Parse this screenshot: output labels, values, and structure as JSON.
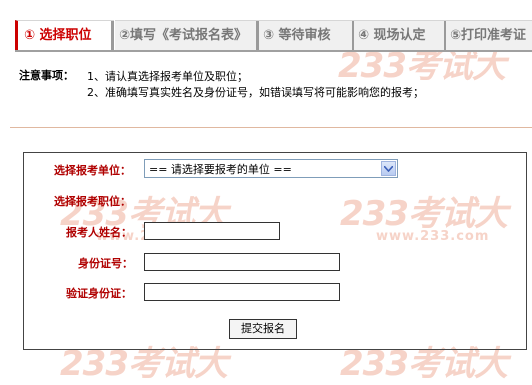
{
  "steps": [
    {
      "label": "① 选择职位"
    },
    {
      "label": "②填写《考试报名表》"
    },
    {
      "label": "③ 等待审核"
    },
    {
      "label": "④ 现场认定"
    },
    {
      "label": "⑤打印准考证"
    }
  ],
  "notes": {
    "title": "注意事项：",
    "lines": [
      "1、请认真选择报考单位及职位；",
      "2、准确填写真实姓名及身份证号，如错误填写将可能影响您的报考；"
    ]
  },
  "form": {
    "unit_label": "选择报考单位：",
    "unit_select_value": "== 请选择要报考的单位 ==",
    "position_label": "选择报考职位：",
    "name_label": "报考人姓名：",
    "name_value": "",
    "id_label": "身份证号：",
    "id_value": "",
    "verify_label": "验证身份证：",
    "verify_value": "",
    "submit_label": "提交报名"
  },
  "watermark": {
    "brand": "233考试大",
    "url": "www.233.com"
  },
  "colors": {
    "accent": "#cc0000",
    "label": "#b00000",
    "watermark": "#f6d3c8"
  }
}
